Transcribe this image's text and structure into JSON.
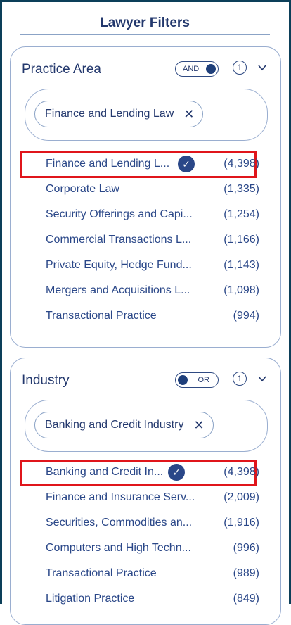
{
  "header": {
    "title": "Lawyer Filters"
  },
  "colors": {
    "accent": "#2a4788",
    "highlight": "#e0151b",
    "frame": "#0c3f59"
  },
  "practice": {
    "title": "Practice Area",
    "toggle_label": "AND",
    "count": "1",
    "chip_label": "Finance and Lending Law",
    "items": [
      {
        "label": "Finance and Lending L...",
        "count": "(4,398)",
        "selected": true
      },
      {
        "label": "Corporate Law",
        "count": "(1,335)"
      },
      {
        "label": "Security Offerings and Capi...",
        "count": "(1,254)"
      },
      {
        "label": "Commercial Transactions L...",
        "count": "(1,166)"
      },
      {
        "label": "Private Equity, Hedge Fund...",
        "count": "(1,143)"
      },
      {
        "label": "Mergers and Acquisitions L...",
        "count": "(1,098)"
      },
      {
        "label": "Transactional Practice",
        "count": "(994)"
      }
    ]
  },
  "industry": {
    "title": "Industry",
    "toggle_label": "OR",
    "count": "1",
    "chip_label": "Banking and Credit Industry",
    "items": [
      {
        "label": "Banking and Credit In...",
        "count": "(4,398)",
        "selected": true
      },
      {
        "label": "Finance and Insurance Serv...",
        "count": "(2,009)"
      },
      {
        "label": "Securities, Commodities an...",
        "count": "(1,916)"
      },
      {
        "label": "Computers and High Techn...",
        "count": "(996)"
      },
      {
        "label": "Transactional Practice",
        "count": "(989)"
      },
      {
        "label": "Litigation Practice",
        "count": "(849)"
      }
    ]
  },
  "icons": {
    "check": "check-icon",
    "close": "close-icon",
    "chevron": "chevron-down-icon"
  }
}
